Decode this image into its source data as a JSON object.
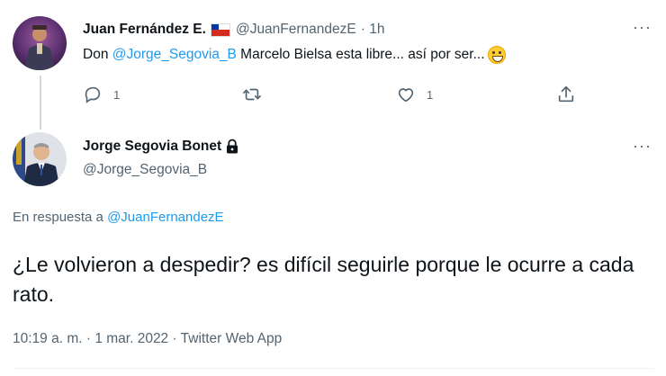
{
  "tweet_parent": {
    "author_name": "Juan Fernández E.",
    "handle": "@JuanFernandezE",
    "time": "· 1h",
    "text_prefix": "Don ",
    "mention": "@Jorge_Segovia_B",
    "text_suffix": " Marcelo Bielsa esta libre... así por ser...",
    "reply_count": "1",
    "like_count": "1"
  },
  "tweet_main": {
    "author_name": "Jorge Segovia Bonet",
    "handle": "@Jorge_Segovia_B",
    "reply_prefix": "En respuesta a ",
    "reply_mention": "@JuanFernandezE",
    "text": "¿Le volvieron a despedir? es difícil seguirle porque le ocurre a cada rato.",
    "meta": "10:19 a. m. · 1 mar. 2022 · Twitter Web App"
  },
  "more_label": "···",
  "icons": [
    "more-icon",
    "reply-icon",
    "retweet-icon",
    "like-icon",
    "share-icon",
    "lock-icon",
    "chile-flag-icon",
    "grin-emoji-icon"
  ],
  "colors": {
    "link": "#1d9bf0",
    "muted": "#536471",
    "text": "#0f1419",
    "thread_line": "#cfd9de"
  }
}
